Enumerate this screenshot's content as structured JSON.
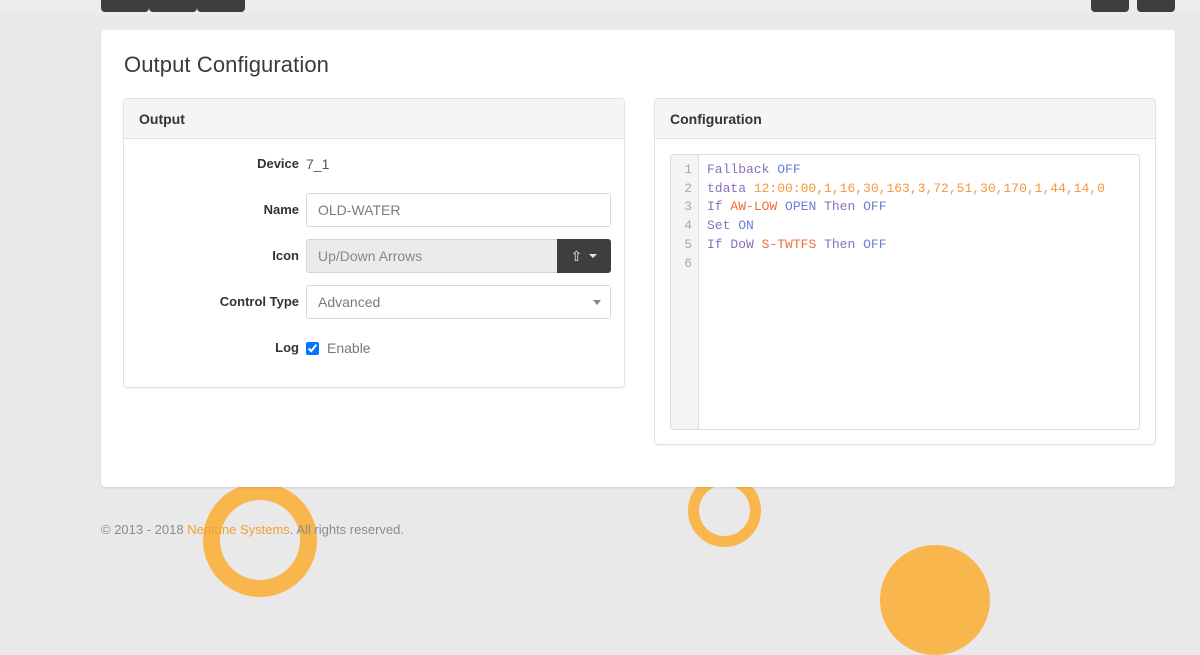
{
  "topbar": {
    "buttons": [
      {
        "name": "nav-button-1",
        "label": ""
      },
      {
        "name": "nav-button-2",
        "label": ""
      },
      {
        "name": "nav-button-3",
        "label": ""
      },
      {
        "name": "nav-button-4",
        "label": ""
      },
      {
        "name": "nav-button-5",
        "label": ""
      }
    ]
  },
  "page": {
    "title": "Output Configuration"
  },
  "output_panel": {
    "title": "Output",
    "fields": {
      "device": {
        "label": "Device",
        "value": "7_1"
      },
      "name": {
        "label": "Name",
        "value": "OLD-WATER",
        "placeholder": "OLD-WATER"
      },
      "icon": {
        "label": "Icon",
        "value": "Up/Down Arrows",
        "placeholder": "Up/Down Arrows",
        "button_icon": "up-arrow-icon",
        "button_glyph": "⇧"
      },
      "control_type": {
        "label": "Control Type",
        "value": "Advanced",
        "options": [
          "Advanced"
        ]
      },
      "log": {
        "label": "Log",
        "checkbox_label": "Enable",
        "checked": true
      }
    }
  },
  "configuration_panel": {
    "title": "Configuration",
    "editor": {
      "line_numbers": [
        "1",
        "2",
        "3",
        "4",
        "5",
        "6"
      ],
      "lines": [
        {
          "number": "1",
          "text": "Fallback OFF",
          "tokens": [
            {
              "t": "Fallback",
              "c": "tok-kw"
            },
            {
              "t": " ",
              "c": "tok-pln"
            },
            {
              "t": "OFF",
              "c": "tok-val"
            }
          ]
        },
        {
          "number": "2",
          "text": "tdata 12:00:00,1,16,30,163,3,72,51,30,170,1,44,14,0",
          "tokens": [
            {
              "t": "tdata",
              "c": "tok-kw"
            },
            {
              "t": " ",
              "c": "tok-pln"
            },
            {
              "t": "12:00:00,1,16,30,163,3,72,51,30,170,1,44,14,0",
              "c": "tok-num"
            }
          ]
        },
        {
          "number": "3",
          "text": "If AW-LOW OPEN Then OFF",
          "tokens": [
            {
              "t": "If",
              "c": "tok-kw"
            },
            {
              "t": " ",
              "c": "tok-pln"
            },
            {
              "t": "AW-LOW",
              "c": "tok-id"
            },
            {
              "t": " ",
              "c": "tok-pln"
            },
            {
              "t": "OPEN",
              "c": "tok-val"
            },
            {
              "t": " ",
              "c": "tok-pln"
            },
            {
              "t": "Then",
              "c": "tok-kw"
            },
            {
              "t": " ",
              "c": "tok-pln"
            },
            {
              "t": "OFF",
              "c": "tok-val"
            }
          ]
        },
        {
          "number": "4",
          "text": "Set ON",
          "tokens": [
            {
              "t": "Set",
              "c": "tok-kw"
            },
            {
              "t": " ",
              "c": "tok-pln"
            },
            {
              "t": "ON",
              "c": "tok-val"
            }
          ]
        },
        {
          "number": "5",
          "text": "If DoW S-TWTFS Then OFF",
          "tokens": [
            {
              "t": "If",
              "c": "tok-kw"
            },
            {
              "t": " ",
              "c": "tok-pln"
            },
            {
              "t": "DoW",
              "c": "tok-kw"
            },
            {
              "t": " ",
              "c": "tok-pln"
            },
            {
              "t": "S-TWTFS",
              "c": "tok-id"
            },
            {
              "t": " ",
              "c": "tok-pln"
            },
            {
              "t": "Then",
              "c": "tok-kw"
            },
            {
              "t": " ",
              "c": "tok-pln"
            },
            {
              "t": "OFF",
              "c": "tok-val"
            }
          ]
        },
        {
          "number": "6",
          "text": "",
          "tokens": []
        }
      ]
    }
  },
  "footer": {
    "prefix": "© 2013 - 2018 ",
    "brand": "Neptune Systems",
    "suffix": ". All rights reserved."
  },
  "colors": {
    "brand_orange": "#f0a136",
    "deco_orange": "#f8b64c",
    "dark_button": "#3e3e3e",
    "page_background": "#e9e9e9",
    "card_background": "#ffffff"
  }
}
